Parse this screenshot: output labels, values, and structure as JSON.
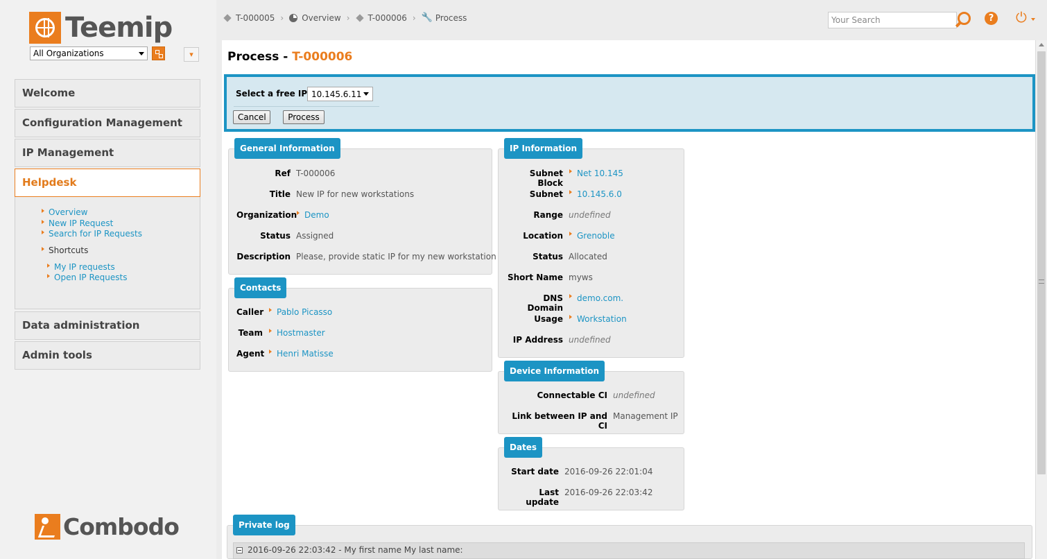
{
  "brand": {
    "name": "Teemip",
    "footer": "Combodo"
  },
  "org_filter": {
    "value": "All Organizations"
  },
  "menu": {
    "welcome": "Welcome",
    "config": "Configuration Management",
    "ip": "IP Management",
    "helpdesk": "Helpdesk",
    "data_admin": "Data administration",
    "admin_tools": "Admin tools"
  },
  "helpdesk_menu": {
    "overview": "Overview",
    "new_request": "New IP Request",
    "search_requests": "Search for IP Requests",
    "shortcuts": "Shortcuts",
    "my_requests": "My IP requests",
    "open_requests": "Open IP Requests"
  },
  "breadcrumbs": [
    "T-000005",
    "Overview",
    "T-000006",
    "Process"
  ],
  "search": {
    "placeholder": "Your Search"
  },
  "icons": {
    "help": "?",
    "power": "⏻",
    "pin": "📌"
  },
  "page": {
    "title_prefix": "Process - ",
    "title_ref": "T-000006"
  },
  "process_form": {
    "label": "Select a free IP",
    "selected_ip": "10.145.6.11",
    "cancel": "Cancel",
    "process": "Process"
  },
  "general": {
    "legend": "General Information",
    "ref_label": "Ref",
    "ref": "T-000006",
    "title_label": "Title",
    "title": "New IP for new workstations",
    "org_label": "Organization",
    "org": "Demo",
    "status_label": "Status",
    "status": "Assigned",
    "desc_label": "Description",
    "desc": "Please, provide static IP for my new workstation"
  },
  "contacts": {
    "legend": "Contacts",
    "caller_label": "Caller",
    "caller": "Pablo Picasso",
    "team_label": "Team",
    "team": "Hostmaster",
    "agent_label": "Agent",
    "agent": "Henri Matisse"
  },
  "ip_info": {
    "legend": "IP Information",
    "subnet_block_label": "Subnet Block",
    "subnet_block": "Net 10.145",
    "subnet_label": "Subnet",
    "subnet": "10.145.6.0",
    "range_label": "Range",
    "range": "undefined",
    "location_label": "Location",
    "location": "Grenoble",
    "status_label": "Status",
    "status": "Allocated",
    "short_name_label": "Short Name",
    "short_name": "myws",
    "dns_label": "DNS Domain",
    "dns": "demo.com.",
    "usage_label": "Usage",
    "usage": "Workstation",
    "ip_label": "IP Address",
    "ip": "undefined"
  },
  "device": {
    "legend": "Device Information",
    "ci_label": "Connectable CI",
    "ci": "undefined",
    "link_label": "Link between IP and CI",
    "link": "Management IP"
  },
  "dates": {
    "legend": "Dates",
    "start_label": "Start date",
    "start": "2016-09-26 22:01:04",
    "update_label": "Last update",
    "update": "2016-09-26 22:03:42"
  },
  "private_log": {
    "legend": "Private log",
    "entry": "2016-09-26 22:03:42 - My first name My last name:"
  }
}
